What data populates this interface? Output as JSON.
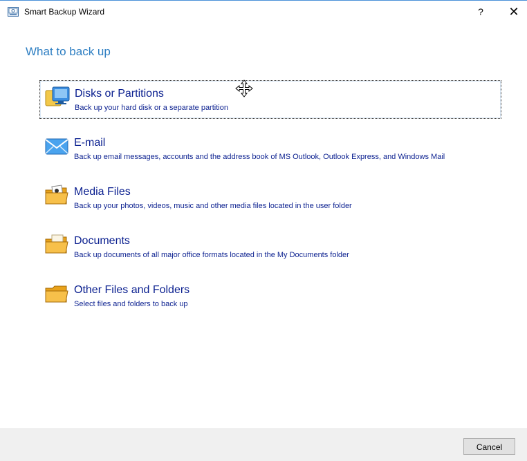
{
  "window": {
    "title": "Smart Backup Wizard",
    "help_label": "?",
    "close_label": "✕"
  },
  "page": {
    "heading": "What to back up"
  },
  "options": [
    {
      "title": "Disks or Partitions",
      "description": "Back up your hard disk or a separate partition",
      "icon": "disk-icon",
      "selected": true
    },
    {
      "title": "E-mail",
      "description": "Back up email messages, accounts and the address book of MS Outlook, Outlook Express, and Windows Mail",
      "icon": "email-icon",
      "selected": false
    },
    {
      "title": "Media Files",
      "description": "Back up your photos, videos, music and other media files located in the user folder",
      "icon": "media-folder-icon",
      "selected": false
    },
    {
      "title": "Documents",
      "description": "Back up documents of all major office formats located in the My Documents folder",
      "icon": "documents-folder-icon",
      "selected": false
    },
    {
      "title": "Other Files and Folders",
      "description": "Select files and folders to back up",
      "icon": "folder-icon",
      "selected": false
    }
  ],
  "footer": {
    "cancel_label": "Cancel"
  },
  "colors": {
    "accent": "#2d7ec2",
    "option_text": "#0a1f8f",
    "footer_bg": "#f0f0f0"
  }
}
